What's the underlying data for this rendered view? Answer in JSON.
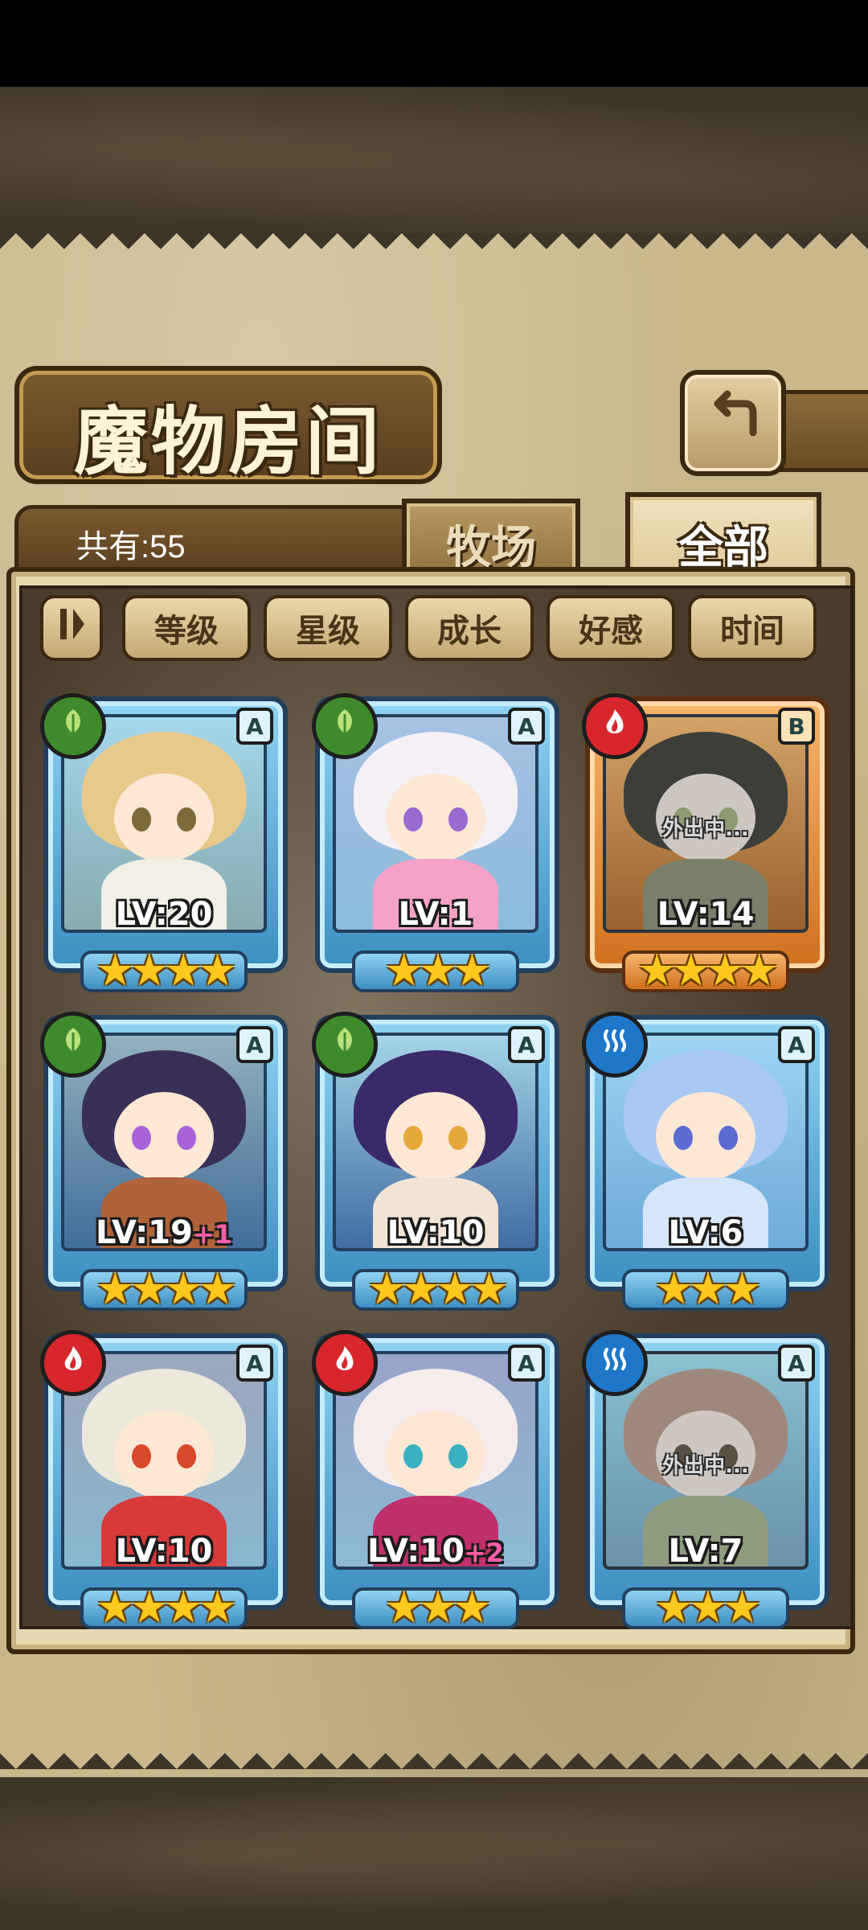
{
  "header": {
    "title": "魔物房间",
    "back_icon": "return-arrow-icon"
  },
  "info": {
    "count_label": "共有:55"
  },
  "tabs": [
    {
      "label": "牧场",
      "active": false
    },
    {
      "label": "全部",
      "active": true
    }
  ],
  "filters": {
    "toggle_icon": "sort-toggle-icon",
    "buttons": [
      "等级",
      "星级",
      "成长",
      "好感",
      "时间"
    ]
  },
  "monsters": [
    {
      "element": "grass",
      "rank": "A",
      "level": "LV:20",
      "bonus": "",
      "stars": "★★★★",
      "away": "",
      "frame": "blue",
      "hair": "#e8c98a",
      "outfit": "#f2efe6",
      "eye": "#7b6a3a"
    },
    {
      "element": "grass",
      "rank": "A",
      "level": "LV:1",
      "bonus": "",
      "stars": "★★★",
      "away": "",
      "frame": "blue",
      "hair": "#f4f0f6",
      "outfit": "#f6a2c8",
      "eye": "#9a6ad0"
    },
    {
      "element": "fire",
      "rank": "B",
      "level": "LV:14",
      "bonus": "",
      "stars": "★★★★",
      "away": "外出中...",
      "frame": "orange",
      "hair": "#4a4a3a",
      "outfit": "#8a9a5a",
      "eye": "#9ac04a"
    },
    {
      "element": "grass",
      "rank": "A",
      "level": "LV:19",
      "bonus": "+1",
      "stars": "★★★★",
      "away": "",
      "frame": "blue",
      "hair": "#3a2f56",
      "outfit": "#b0623a",
      "eye": "#a862d8"
    },
    {
      "element": "grass",
      "rank": "A",
      "level": "LV:10",
      "bonus": "",
      "stars": "★★★★",
      "away": "",
      "frame": "blue",
      "hair": "#3a2a6a",
      "outfit": "#f2e4d4",
      "eye": "#e6a83a"
    },
    {
      "element": "water",
      "rank": "A",
      "level": "LV:6",
      "bonus": "",
      "stars": "★★★",
      "away": "",
      "frame": "blue",
      "hair": "#a9c8f2",
      "outfit": "#d6e6fa",
      "eye": "#5a6ad0"
    },
    {
      "element": "fire",
      "rank": "A",
      "level": "LV:10",
      "bonus": "",
      "stars": "★★★★",
      "away": "",
      "frame": "blue",
      "hair": "#ece8dc",
      "outfit": "#d83a3a",
      "eye": "#d84a2a"
    },
    {
      "element": "fire",
      "rank": "A",
      "level": "LV:10",
      "bonus": "+2",
      "stars": "★★★",
      "away": "",
      "frame": "blue",
      "hair": "#f6ecec",
      "outfit": "#c0306a",
      "eye": "#3ab0c0"
    },
    {
      "element": "water",
      "rank": "A",
      "level": "LV:7",
      "bonus": "",
      "stars": "★★★",
      "away": "外出中...",
      "frame": "blue",
      "hair": "#d89a7a",
      "outfit": "#9ac06a",
      "eye": "#7a5a3a"
    }
  ],
  "element_icons": {
    "grass": "leaf-icon",
    "fire": "flame-icon",
    "water": "water-wave-icon"
  },
  "colors": {
    "parchment": "#c9b88c",
    "wood_dark": "#3b2810",
    "frame_blue": "#3d8ec2",
    "frame_orange": "#d0701f",
    "star": "#ffc81e",
    "bonus": "#ff5fa8"
  }
}
